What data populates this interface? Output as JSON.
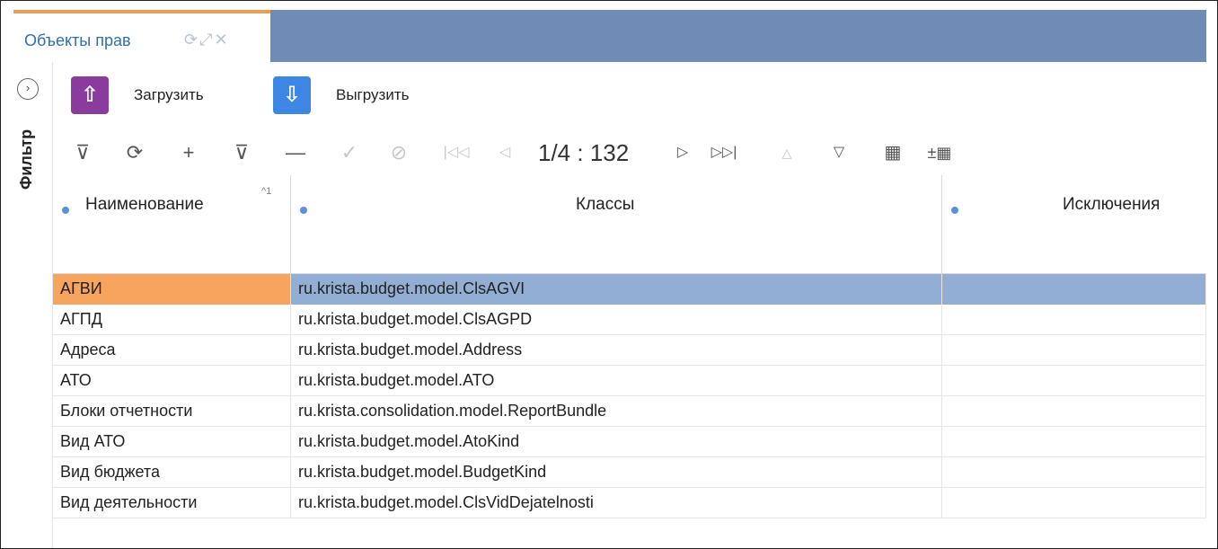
{
  "tab": {
    "title": "Объекты прав",
    "icons": [
      "refresh-icon",
      "expand-icon",
      "close-icon"
    ]
  },
  "sidebar": {
    "filter_label": "Фильтр",
    "toggle_icon": "chevron-right-circle-icon"
  },
  "actions": {
    "upload_label": "Загрузить",
    "download_label": "Выгрузить",
    "upload_color": "#8a3b9e",
    "download_color": "#3d86e3"
  },
  "toolbar": {
    "pager_text": "1/4 : 132",
    "buttons": [
      "filter-icon",
      "refresh-icon",
      "add-icon",
      "filter-row-icon",
      "remove-icon",
      "confirm-icon",
      "cancel-icon",
      "first-page-icon",
      "prev-page-icon",
      "next-page-icon",
      "last-page-icon",
      "sort-up-icon",
      "sort-down-icon",
      "columns-icon",
      "group-icon"
    ]
  },
  "table": {
    "columns": [
      "Наименование",
      "Классы",
      "Исключения"
    ],
    "sort_indicator": "^1",
    "rows": [
      {
        "name": "АГВИ",
        "cls": "ru.krista.budget.model.ClsAGVI",
        "exc": ""
      },
      {
        "name": "АГПД",
        "cls": "ru.krista.budget.model.ClsAGPD",
        "exc": ""
      },
      {
        "name": "Адреса",
        "cls": "ru.krista.budget.model.Address",
        "exc": ""
      },
      {
        "name": "АТО",
        "cls": "ru.krista.budget.model.ATO",
        "exc": ""
      },
      {
        "name": "Блоки отчетности",
        "cls": "ru.krista.consolidation.model.ReportBundle",
        "exc": ""
      },
      {
        "name": "Вид АТО",
        "cls": "ru.krista.budget.model.AtoKind",
        "exc": ""
      },
      {
        "name": "Вид бюджета",
        "cls": "ru.krista.budget.model.BudgetKind",
        "exc": ""
      },
      {
        "name": "Вид деятельности",
        "cls": "ru.krista.budget.model.ClsVidDejatelnosti",
        "exc": ""
      }
    ],
    "selected_row": 0,
    "selected_name_color": "#f6a45e",
    "selected_row_color": "#93aed4"
  },
  "colors": {
    "tabstrip": "#6e8cb5",
    "tab_accent": "#ef9a55",
    "link": "#2f6fad"
  }
}
